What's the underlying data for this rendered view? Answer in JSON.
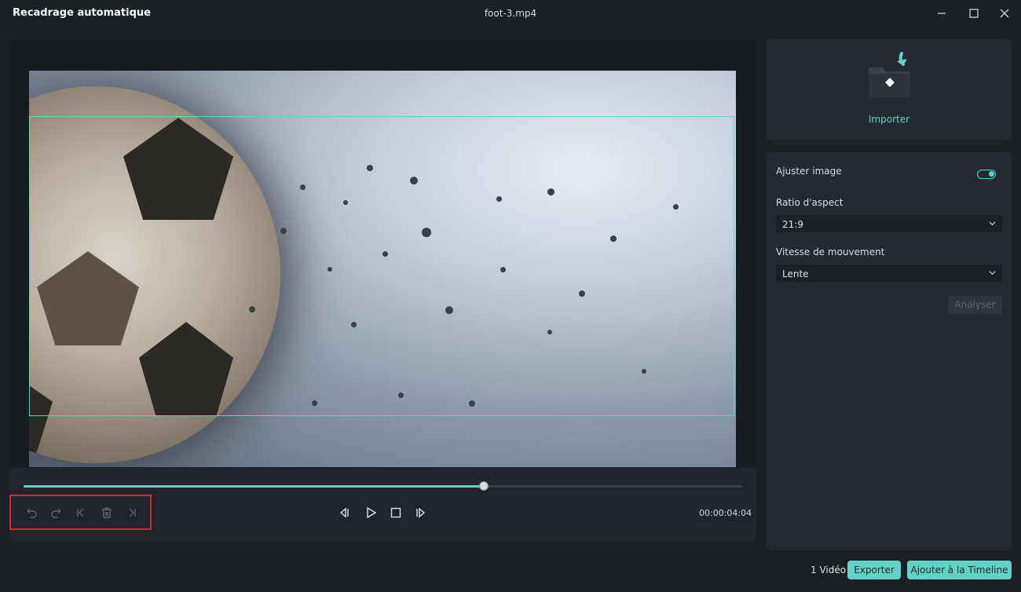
{
  "window": {
    "title": "Recadrage automatique",
    "file_name": "foot-3.mp4"
  },
  "player": {
    "progress_fraction": 0.64,
    "timecode": "00:00:04:04",
    "controls": [
      "undo-icon",
      "redo-icon",
      "jump-start-icon",
      "delete-icon",
      "jump-end-icon",
      "prev-frame-icon",
      "play-icon",
      "stop-icon",
      "next-frame-icon"
    ]
  },
  "import": {
    "label": "Importer"
  },
  "settings": {
    "adjust_label": "Ajuster image",
    "adjust_on": true,
    "ratio_label": "Ratio d'aspect",
    "ratio_value": "21:9",
    "speed_label": "Vitesse de mouvement",
    "speed_value": "Lente",
    "analyze_label": "Analyser"
  },
  "footer": {
    "count": "1 Vidéo",
    "export_label": "Exporter",
    "timeline_label": "Ajouter à la Timeline"
  },
  "colors": {
    "accent": "#5fd4c6",
    "highlight": "#e0262c",
    "background": "#1c1f24"
  }
}
